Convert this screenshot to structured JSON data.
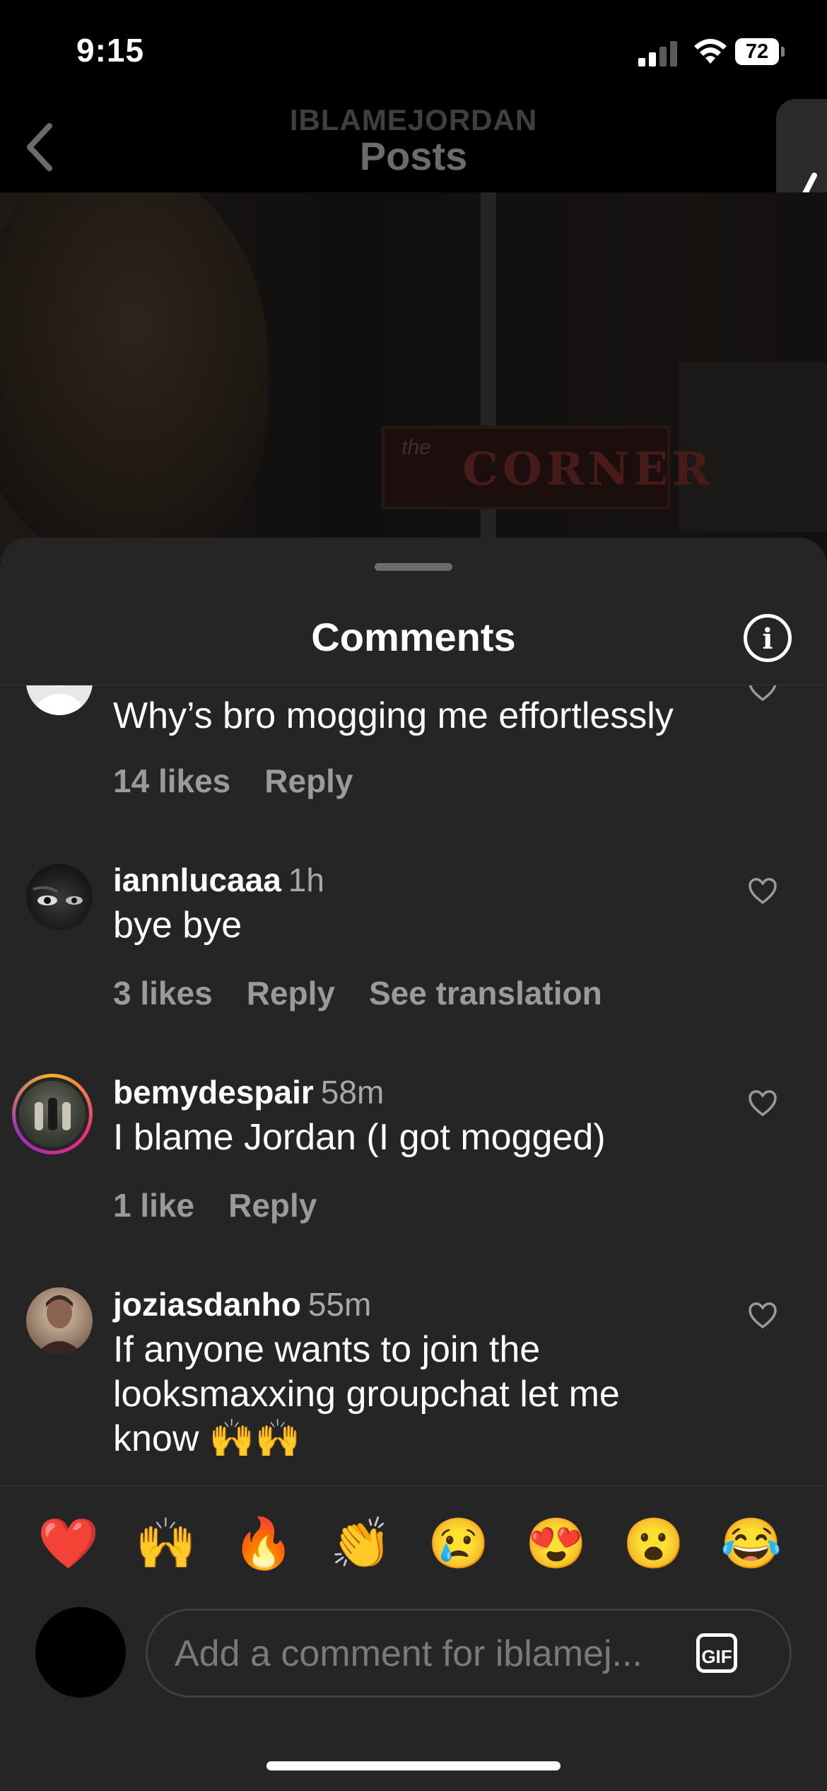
{
  "status_bar": {
    "time": "9:15",
    "battery": "72"
  },
  "header": {
    "username": "IBLAMEJORDAN",
    "title": "Posts"
  },
  "post_image": {
    "sign_word": "CORNER",
    "sign_prefix": "the"
  },
  "sheet": {
    "title": "Comments"
  },
  "comments": [
    {
      "username": "",
      "ago": "",
      "text": "Why’s bro mogging me effortlessly",
      "likes": "14 likes",
      "reply": "Reply",
      "translate": ""
    },
    {
      "username": "iannlucaaa",
      "ago": "1h",
      "text": "bye bye",
      "likes": "3 likes",
      "reply": "Reply",
      "translate": "See translation"
    },
    {
      "username": "bemydespair",
      "ago": "58m",
      "text": "I blame Jordan (I got mogged)",
      "likes": "1 like",
      "reply": "Reply",
      "translate": ""
    },
    {
      "username": "joziasdanho",
      "ago": "55m",
      "text": "If anyone wants to join the looksmaxxing groupchat let me know 🙌🙌",
      "likes": "",
      "reply": "",
      "translate": ""
    }
  ],
  "reactions": [
    "❤️",
    "🙌",
    "🔥",
    "👏",
    "😢",
    "😍",
    "😮",
    "😂"
  ],
  "composer": {
    "placeholder": "Add a comment for iblamej...",
    "gif_label": "GIF"
  },
  "colors": {
    "background": "#000000",
    "sheet": "#252525",
    "secondary_text": "#a8a8a8"
  }
}
